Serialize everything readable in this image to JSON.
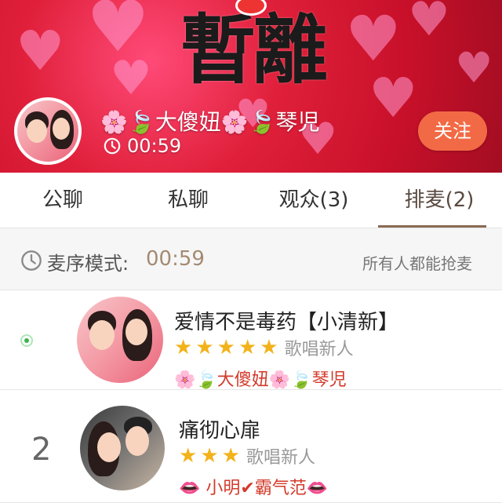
{
  "header": {
    "banner_text": "暫離",
    "host_name": "🌸🍃大傻妞🌸🍃琴児",
    "timer": "00:59",
    "follow_label": "关注"
  },
  "tabs": [
    {
      "label": "公聊",
      "active": false
    },
    {
      "label": "私聊",
      "active": false
    },
    {
      "label": "观众(3)",
      "active": false
    },
    {
      "label": "排麦(2)",
      "active": true
    }
  ],
  "mic_order": {
    "label": "麦序模式:",
    "time": "00:59",
    "rule": "所有人都能抢麦"
  },
  "queue": [
    {
      "rank": "",
      "status_icon": "live-dot-icon",
      "song": "爱情不是毒药【小清新】",
      "stars": 5,
      "level": "歌唱新人",
      "singer": "🌸🍃大傻妞🌸🍃琴児"
    },
    {
      "rank": "2",
      "song": "痛彻心扉",
      "stars": 3,
      "level": "歌唱新人",
      "singer": "👄 小明✔霸气范👄"
    }
  ],
  "colors": {
    "accent": "#f26a45",
    "banner_red": "#d8182f",
    "star": "#f2b21a",
    "singer_text": "#d23a2a",
    "timer_text": "#a48a72"
  }
}
